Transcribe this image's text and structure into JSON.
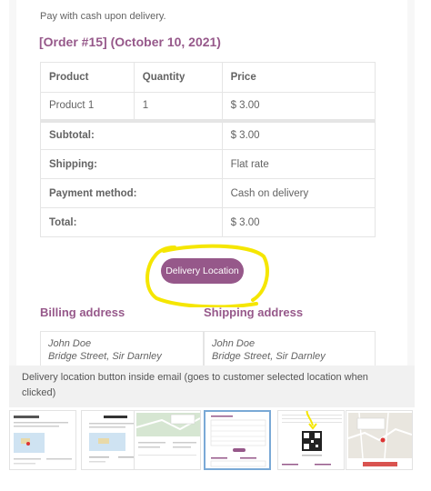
{
  "email": {
    "payment_note": "Pay with cash upon delivery.",
    "order_heading": "[Order #15] (October 10, 2021)",
    "table": {
      "headers": [
        "Product",
        "Quantity",
        "Price"
      ],
      "items": [
        {
          "product": "Product 1",
          "quantity": "1",
          "price": "$ 3.00"
        }
      ],
      "totals": [
        {
          "label": "Subtotal:",
          "value": "$ 3.00"
        },
        {
          "label": "Shipping:",
          "value": "Flat rate"
        },
        {
          "label": "Payment method:",
          "value": "Cash on delivery"
        },
        {
          "label": "Total:",
          "value": "$ 3.00"
        }
      ]
    },
    "delivery_button": "Delivery Location",
    "billing": {
      "heading": "Billing address",
      "name": "John Doe",
      "street": "Bridge Street, Sir Darnley"
    },
    "shipping": {
      "heading": "Shipping address",
      "name": "John Doe",
      "street": "Bridge Street, Sir Darnley"
    }
  },
  "caption": "Delivery location button inside email (goes to customer selected location when clicked)",
  "thumbnails": [
    {
      "name": "thumb-order-received",
      "active": false
    },
    {
      "name": "thumb-order-email",
      "active": false
    },
    {
      "name": "thumb-map-view",
      "active": false
    },
    {
      "name": "thumb-delivery-button-email",
      "active": true
    },
    {
      "name": "thumb-qr-code",
      "active": false
    },
    {
      "name": "thumb-location-map",
      "active": false
    }
  ],
  "colors": {
    "accent": "#96588a",
    "highlight": "#f5e600",
    "border": "#e5e5e5",
    "active_thumb_border": "#7aa9d6"
  }
}
